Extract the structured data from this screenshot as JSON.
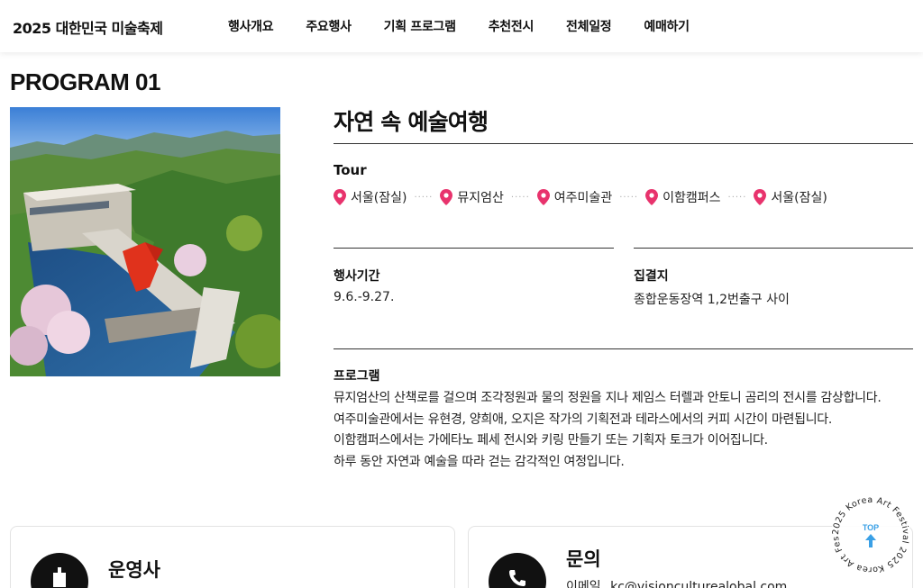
{
  "header": {
    "logo": "2025 대한민국 미술축제",
    "nav": [
      "행사개요",
      "주요행사",
      "기획 프로그램",
      "추천전시",
      "전체일정",
      "예매하기"
    ]
  },
  "program": {
    "label": "PROGRAM 01",
    "title": "자연 속 예술여행",
    "tour_heading": "Tour",
    "route": [
      "서울(잠실)",
      "뮤지엄산",
      "여주미술관",
      "이함캠퍼스",
      "서울(잠실)"
    ],
    "period_heading": "행사기간",
    "period_value": "9.6.-9.27.",
    "meeting_heading": "집결지",
    "meeting_value": "종합운동장역 1,2번출구 사이",
    "program_heading": "프로그램",
    "description": [
      "뮤지엄산의 산책로를 걸으며 조각정원과 물의 정원을 지나 제임스 터렐과 안토니 곰리의 전시를 감상합니다.",
      "여주미술관에서는 유현경, 양희애, 오지은 작가의 기획전과 테라스에서의 커피 시간이 마련됩니다.",
      "이함캠퍼스에서는 가에타노 페세 전시와 키링 만들기 또는 기획자 토크가 이어집니다.",
      "하루 동안 자연과 예술을 따라 걷는 감각적인 여정입니다."
    ]
  },
  "cards": {
    "operator_title": "운영사",
    "contact_title": "문의",
    "contact_email_label": "이메일",
    "contact_email": "kc@visionculturealobal.com"
  },
  "top_badge": {
    "label": "TOP",
    "ring_text": "2025 Korea Art Festival 2025 Korea Art Festival"
  },
  "colors": {
    "pin": "#e8336d",
    "top_accent": "#3aa0e6"
  }
}
